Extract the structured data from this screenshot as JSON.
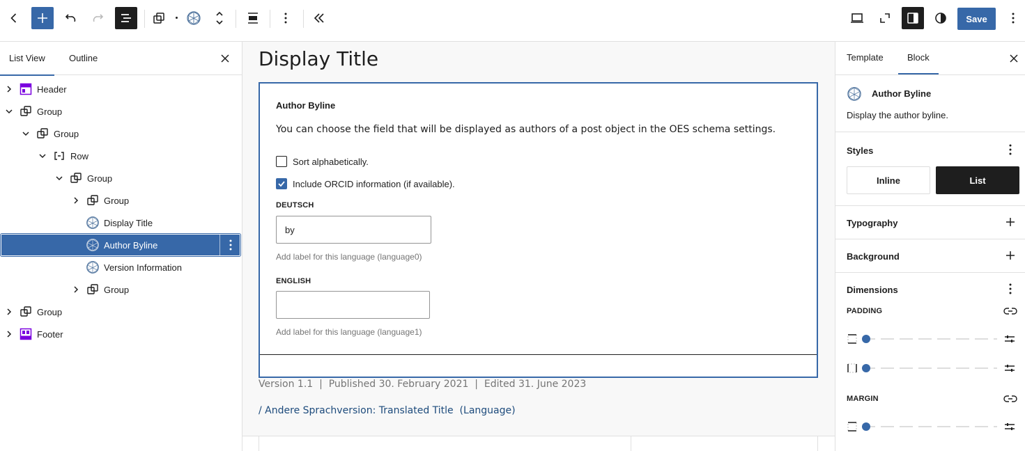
{
  "toolbar": {
    "save_label": "Save",
    "icons": [
      "chevron-left-icon",
      "plus-icon",
      "undo-icon",
      "redo-icon",
      "list-view-icon",
      "group-icon",
      "oes-block-icon",
      "move-arrows-icon",
      "align-icon",
      "more-vertical-icon",
      "collapse-icon",
      "desktop-preview-icon",
      "fullscreen-icon",
      "sidebar-toggle-icon",
      "contrast-icon",
      "options-icon"
    ]
  },
  "left_panel": {
    "tabs": [
      {
        "label": "List View"
      },
      {
        "label": "Outline"
      }
    ],
    "tree": [
      {
        "label": "Header"
      },
      {
        "label": "Group"
      },
      {
        "label": "Group"
      },
      {
        "label": "Row"
      },
      {
        "label": "Group"
      },
      {
        "label": "Group"
      },
      {
        "label": "Display Title"
      },
      {
        "label": "Author Byline"
      },
      {
        "label": "Version Information"
      },
      {
        "label": "Group"
      },
      {
        "label": "Group"
      },
      {
        "label": "Footer"
      }
    ]
  },
  "canvas": {
    "page_title": "Display Title",
    "block": {
      "title": "Author Byline",
      "description": "You can choose the field that will be displayed as authors of a post object in the OES schema settings.",
      "checkbox_sort": "Sort alphabetically.",
      "checkbox_orcid": "Include ORCID information (if available).",
      "lang0_label": "DEUTSCH",
      "lang0_value": "by",
      "lang0_help": "Add label for this language (language0)",
      "lang1_label": "ENGLISH",
      "lang1_value": "",
      "lang1_help": "Add label for this language (language1)"
    },
    "version_line": "Version 1.1  |  Published 30. February 2021  |  Edited 31. June 2023",
    "translation_link": "/ Andere Sprachversion: Translated Title  (Language)"
  },
  "right_panel": {
    "tabs": [
      {
        "label": "Template"
      },
      {
        "label": "Block"
      }
    ],
    "block_name": "Author Byline",
    "block_desc": "Display the author byline.",
    "styles_heading": "Styles",
    "style_inline": "Inline",
    "style_list": "List",
    "typography": "Typography",
    "background": "Background",
    "dimensions": "Dimensions",
    "padding": "PADDING",
    "margin": "MARGIN"
  },
  "colors": {
    "accent": "#3768a8",
    "dark": "#1e1e1e",
    "purple_template_part": "#7a00df",
    "link": "#1d4b7c"
  }
}
